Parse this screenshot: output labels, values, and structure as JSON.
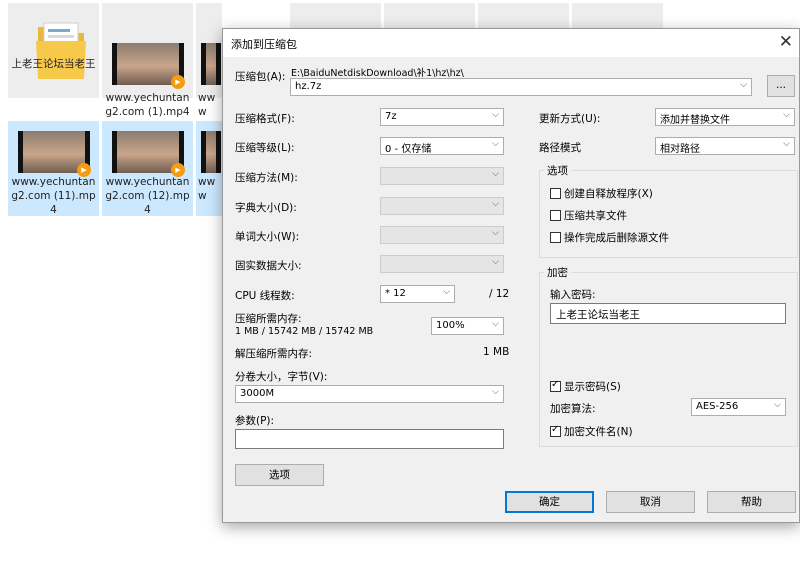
{
  "explorer": {
    "tiles": [
      {
        "label": "上老王论坛当老王",
        "type": "folder"
      },
      {
        "label": "www.yechuntang2.com (1).mp4",
        "type": "video"
      },
      {
        "label": "www",
        "type": "video"
      },
      {
        "label": "www.yechuntang2.com (11).mp4",
        "type": "video"
      },
      {
        "label": "www.yechuntang2.com (12).mp4",
        "type": "video"
      },
      {
        "label": "www",
        "type": "video"
      }
    ]
  },
  "dialog": {
    "title": "添加到压缩包",
    "archive_label": "压缩包(A):",
    "archive_path": "E:\\BaiduNetdiskDownload\\补1\\hz\\hz\\",
    "archive_name": "hz.7z",
    "browse_label": "...",
    "format_label": "压缩格式(F):",
    "format_value": "7z",
    "level_label": "压缩等级(L):",
    "level_value": "0 - 仅存储",
    "method_label": "压缩方法(M):",
    "dict_label": "字典大小(D):",
    "word_label": "单词大小(W):",
    "solid_label": "固实数据大小:",
    "cpu_label": "CPU 线程数:",
    "cpu_value": "* 12",
    "cpu_total": "/ 12",
    "mem_comp_label": "压缩所需内存:",
    "mem_comp_value": "1 MB / 15742 MB / 15742 MB",
    "mem_percent": "100%",
    "mem_decomp_label": "解压缩所需内存:",
    "mem_decomp_value": "1 MB",
    "split_label": "分卷大小，字节(V):",
    "split_value": "3000M",
    "params_label": "参数(P):",
    "params_value": "",
    "options_button": "选项",
    "update_label": "更新方式(U):",
    "update_value": "添加并替换文件",
    "path_label": "路径模式",
    "path_value": "相对路径",
    "options_group": "选项",
    "opt_sfx": "创建自释放程序(X)",
    "opt_shared": "压缩共享文件",
    "opt_delete": "操作完成后删除源文件",
    "enc_group": "加密",
    "password_label": "输入密码:",
    "password_value": "上老王论坛当老王",
    "show_password": "显示密码(S)",
    "enc_method_label": "加密算法:",
    "enc_method_value": "AES-256",
    "enc_filenames": "加密文件名(N)",
    "ok_button": "确定",
    "cancel_button": "取消",
    "help_button": "帮助"
  },
  "colors": {
    "dialog_bg": "#f0f0f0",
    "selection": "#cce8ff",
    "accent": "#0078d7"
  }
}
